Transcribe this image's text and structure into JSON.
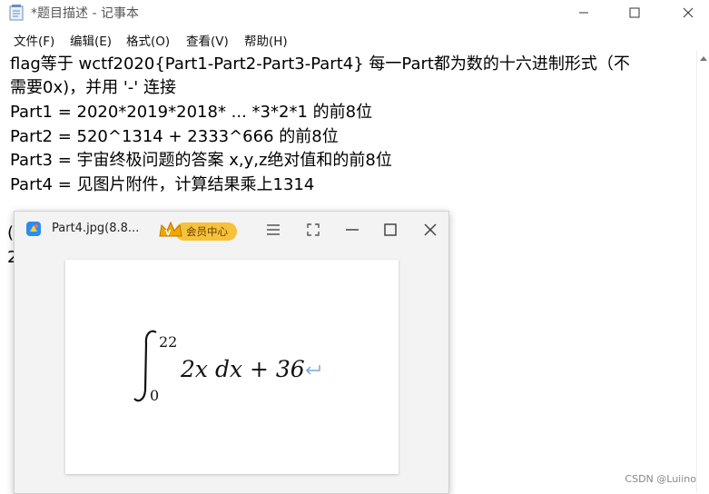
{
  "notepad": {
    "title": "*题目描述 - 记事本",
    "menu": [
      "文件(F)",
      "编辑(E)",
      "格式(O)",
      "查看(V)",
      "帮助(H)"
    ],
    "lines": [
      "flag等于 wctf2020{Part1-Part2-Part3-Part4} 每一Part都为数的十六进制形式（不",
      "需要0x)，并用 '-' 连接",
      "Part1 = 2020*2019*2018* ... *3*2*1 的前8位",
      "Part2 = 520^1314 + 2333^666 的前8位",
      "Part3 = 宇宙终极问题的答案 x,y,z绝对值和的前8位",
      "Part4 = 见图片附件，计算结果乘上1314"
    ],
    "partial_chars": [
      "(",
      "2"
    ]
  },
  "viewer": {
    "title": "Part4.jpg(8.8...",
    "vip_label": "会员中心",
    "formula": {
      "upper_limit": "22",
      "lower_limit": "0",
      "integrand": "2x dx + 36"
    }
  },
  "watermark": "CSDN @Luiino",
  "colors": {
    "accent_yellow": "#f6c23a",
    "return_mark": "#7fa7d9"
  }
}
